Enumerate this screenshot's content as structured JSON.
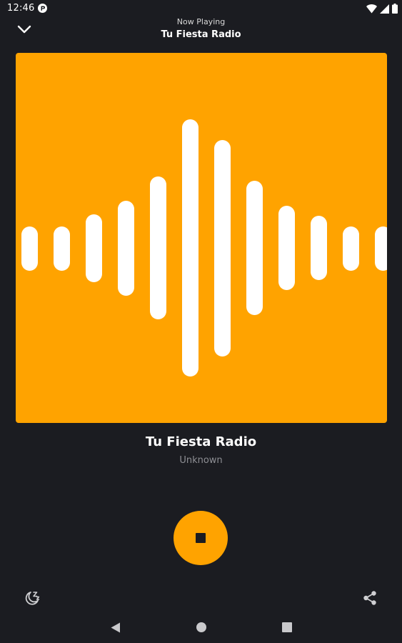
{
  "status_bar": {
    "time": "12:46",
    "icons": [
      "app-notification-icon",
      "wifi-icon",
      "cellular-signal-icon",
      "battery-icon"
    ]
  },
  "header": {
    "subtitle": "Now Playing",
    "title": "Tu Fiesta Radio",
    "collapse_icon": "chevron-down-icon"
  },
  "artwork": {
    "background_color": "#ffa300",
    "bar_color": "#ffffff",
    "icon": "sound-wave-icon"
  },
  "track": {
    "title": "Tu Fiesta Radio",
    "artist": "Unknown"
  },
  "controls": {
    "stop_icon": "stop-icon",
    "accent_color": "#ffa300",
    "sleep_timer_icon": "sleep-timer-icon",
    "share_icon": "share-icon"
  },
  "nav_bar": {
    "icons": [
      "back-icon",
      "home-icon",
      "recents-icon"
    ]
  }
}
